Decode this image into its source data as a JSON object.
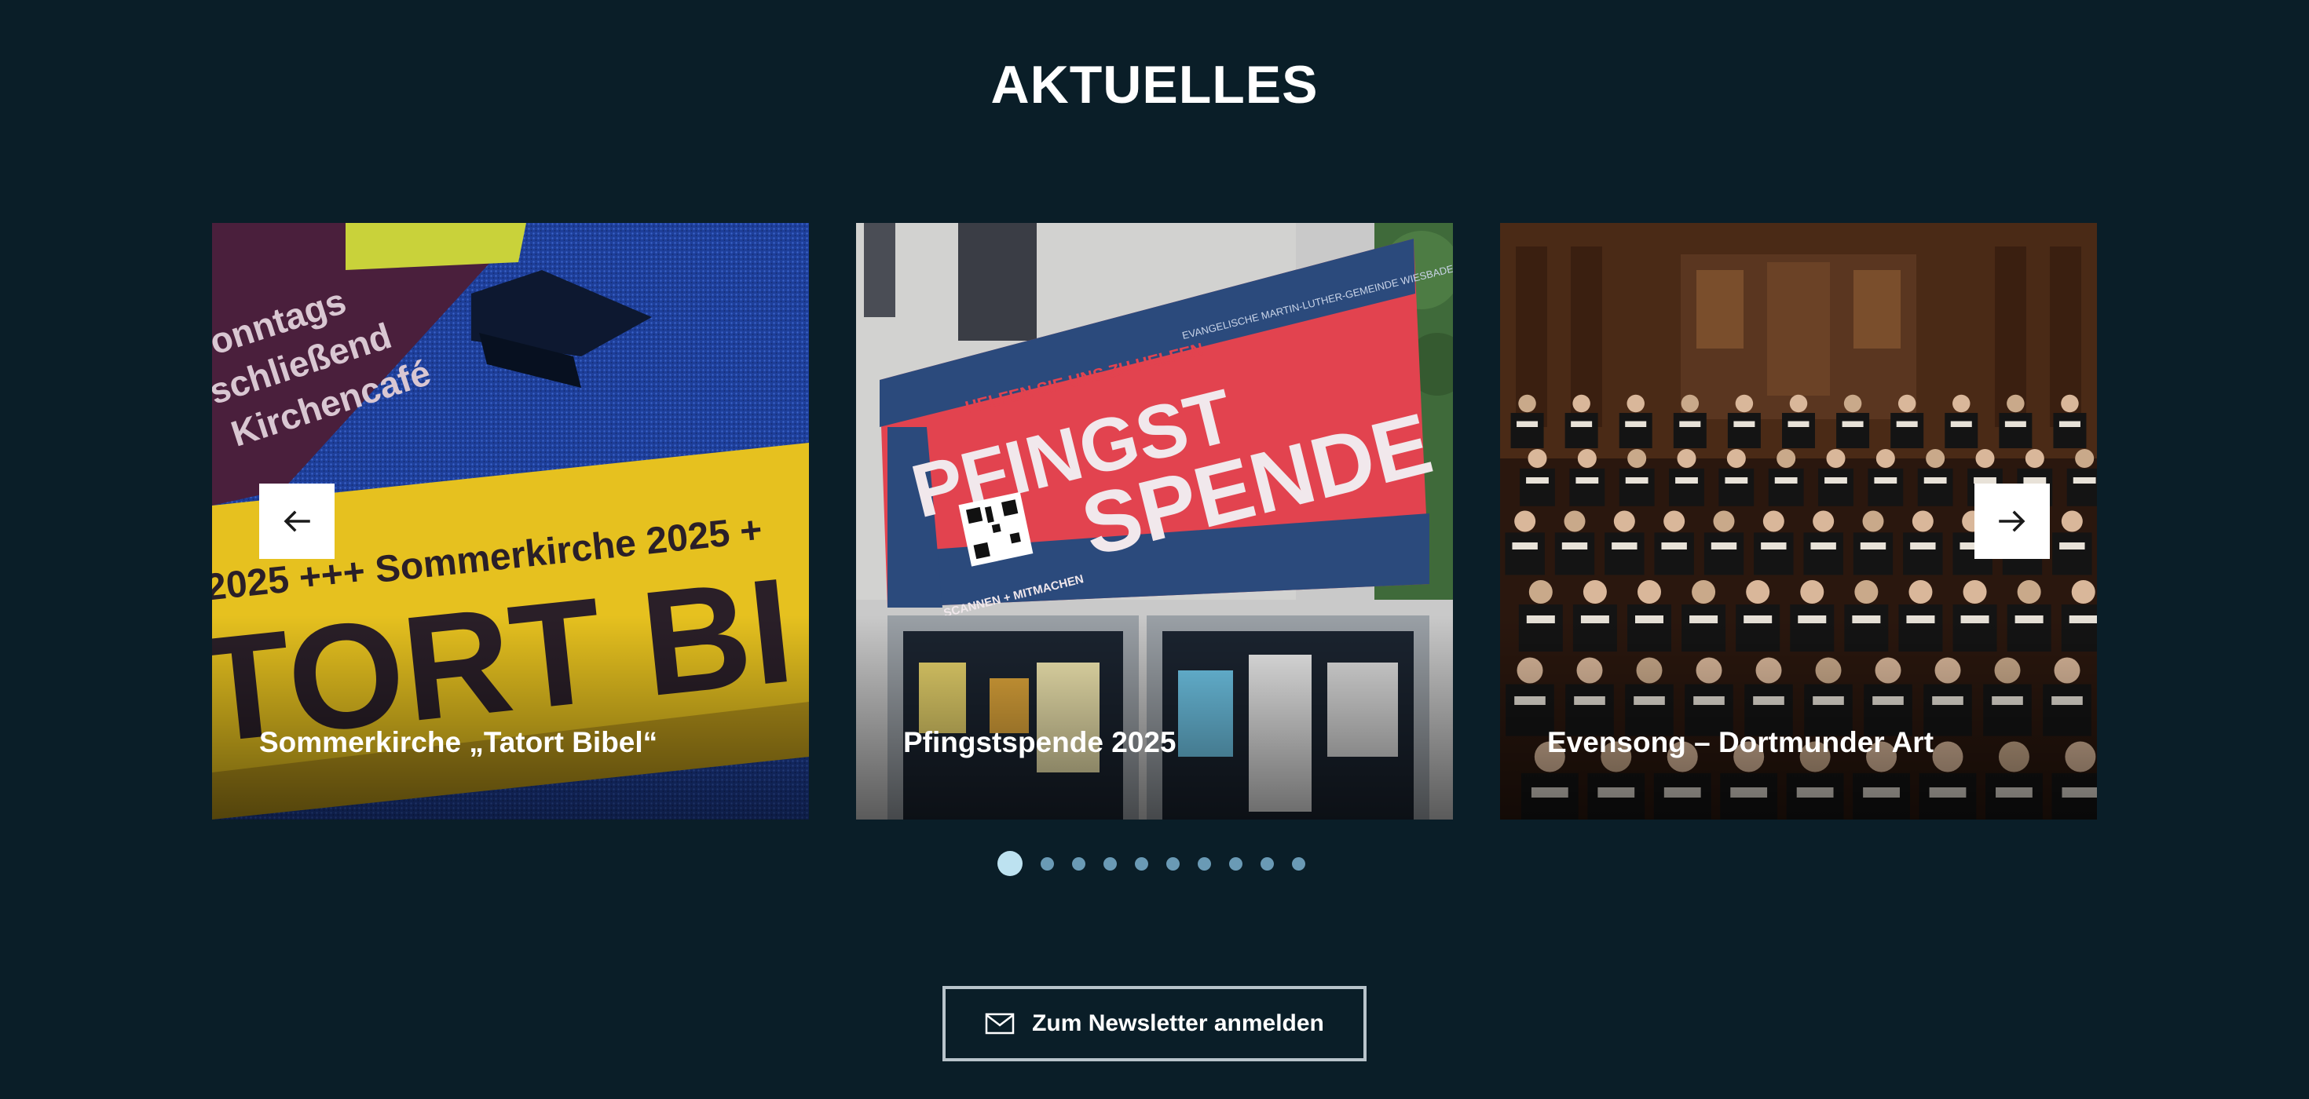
{
  "section": {
    "title": "AKTUELLES"
  },
  "carousel": {
    "cards": [
      {
        "caption": "Sommerkirche „Tatort Bibel“",
        "image_text": {
          "sign_lines": [
            "onntags",
            "schließend",
            "Kirchencafé"
          ],
          "ribbon_line": "2025 +++ Sommerkirche 2025 +",
          "big_text": "TORT BI"
        }
      },
      {
        "caption": "Pfingstspende 2025",
        "image_text": {
          "banner_top": "HELFEN SIE UNS ZU HELFEN",
          "banner_word1": "PFINGST",
          "banner_word2": "SPENDE",
          "banner_scan": "SCANNEN + MITMACHEN",
          "banner_org": "EVANGELISCHE MARTIN-LUTHER-GEMEINDE WIESBADEN"
        }
      },
      {
        "caption": "Evensong – Dortmunder Art"
      }
    ],
    "prev_icon": "arrow-left-icon",
    "next_icon": "arrow-right-icon",
    "pagination": {
      "total": 10,
      "active_index": 0
    }
  },
  "newsletter": {
    "icon": "mail-icon",
    "label": "Zum Newsletter anmelden"
  },
  "colors": {
    "background": "#0a1e28",
    "dot_active": "#bde2f0",
    "dot_inactive": "#6a9ab5",
    "button_border": "#b8c4cb",
    "banner_red": "#e2434f",
    "banner_blue": "#2b4a7c",
    "ribbon_yellow": "#e6c11f"
  }
}
